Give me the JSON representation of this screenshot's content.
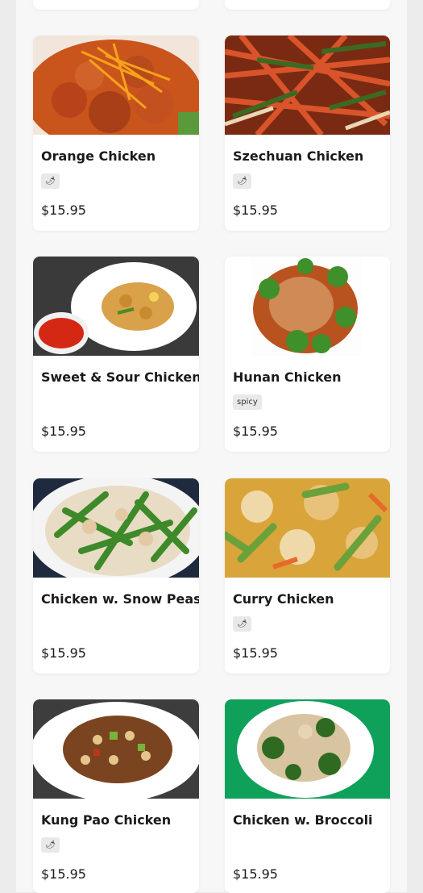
{
  "menu_items": [
    {
      "name": "Orange Chicken",
      "badge": "🌶",
      "price": "$15.95",
      "icon": "pepper-icon"
    },
    {
      "name": "Szechuan Chicken",
      "badge": "🌶",
      "price": "$15.95",
      "icon": "pepper-icon"
    },
    {
      "name": "Sweet & Sour Chicken",
      "badge": "",
      "price": "$15.95"
    },
    {
      "name": "Hunan Chicken",
      "badge": "spicy",
      "price": "$15.95"
    },
    {
      "name": "Chicken w. Snow Peas",
      "badge": "",
      "price": "$15.95"
    },
    {
      "name": "Curry Chicken",
      "badge": "🌶",
      "price": "$15.95",
      "icon": "pepper-icon"
    },
    {
      "name": "Kung Pao Chicken",
      "badge": "🌶",
      "price": "$15.95",
      "icon": "pepper-icon"
    },
    {
      "name": "Chicken w. Broccoli",
      "badge": "",
      "price": "$15.95"
    }
  ],
  "colors": {
    "page_bg": "#ececec",
    "panel_bg": "#f7f7f7",
    "card_bg": "#ffffff",
    "badge_bg": "#e9e9e9",
    "broccoli_plate_bg": "#0fa05a"
  }
}
